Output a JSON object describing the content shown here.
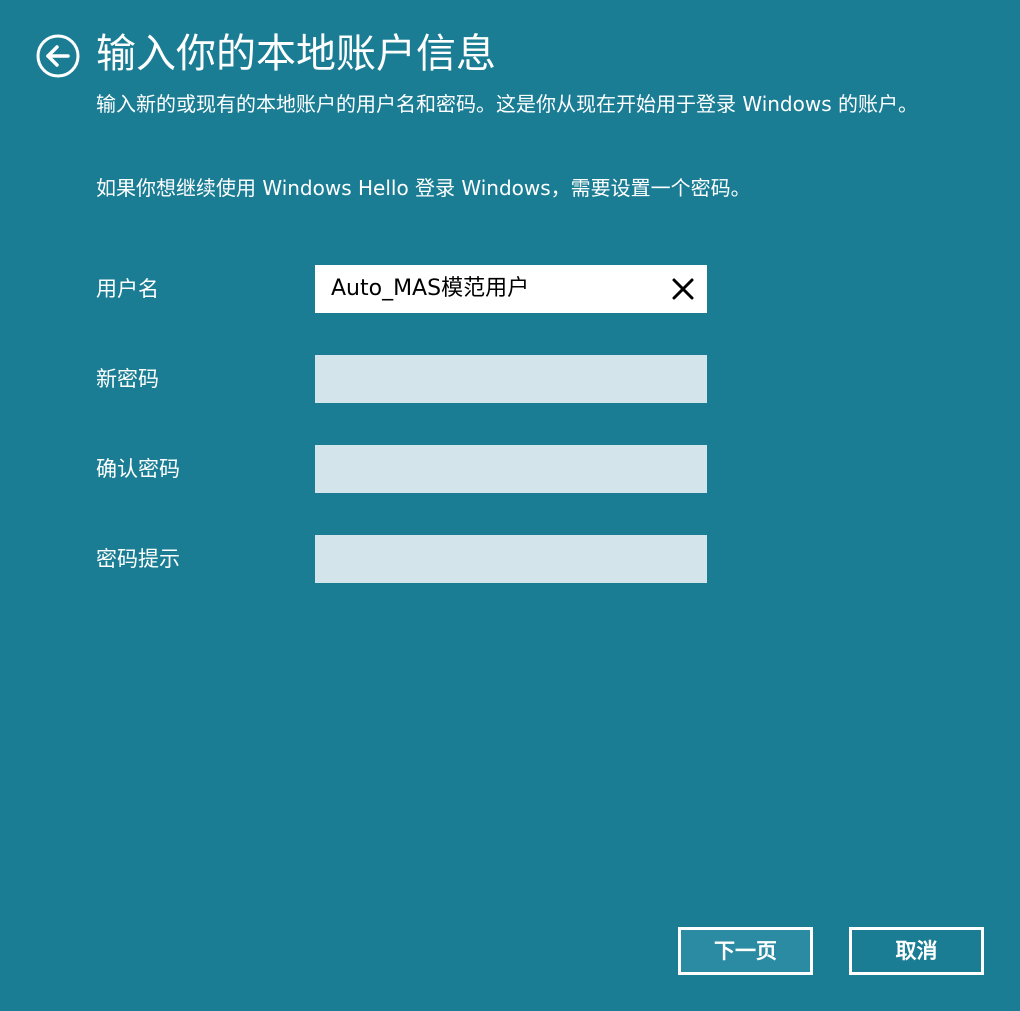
{
  "header": {
    "title": "输入你的本地账户信息"
  },
  "description": {
    "line1": "输入新的或现有的本地账户的用户名和密码。这是你从现在开始用于登录 Windows 的账户。",
    "line2": "如果你想继续使用 Windows Hello 登录 Windows，需要设置一个密码。"
  },
  "form": {
    "username": {
      "label": "用户名",
      "value": "Auto_MAS模范用户"
    },
    "new_password": {
      "label": "新密码",
      "value": ""
    },
    "confirm_password": {
      "label": "确认密码",
      "value": ""
    },
    "password_hint": {
      "label": "密码提示",
      "value": ""
    }
  },
  "buttons": {
    "next_label": "下一页",
    "cancel_label": "取消"
  },
  "icons": {
    "back": "back-arrow-circle-icon",
    "clear": "close-icon"
  },
  "colors": {
    "background": "#1a7d94",
    "input_inactive": "#d3e5ea",
    "input_active": "#ffffff",
    "text": "#ffffff"
  }
}
